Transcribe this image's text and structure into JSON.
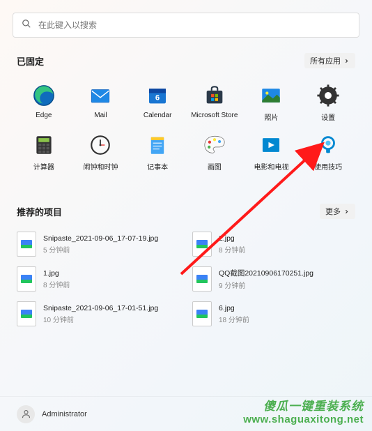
{
  "search": {
    "placeholder": "在此键入以搜索"
  },
  "pinned": {
    "title": "已固定",
    "action": "所有应用",
    "apps": [
      {
        "name": "Edge"
      },
      {
        "name": "Mail"
      },
      {
        "name": "Calendar"
      },
      {
        "name": "Microsoft Store"
      },
      {
        "name": "照片"
      },
      {
        "name": "设置"
      },
      {
        "name": "计算器"
      },
      {
        "name": "闹钟和时钟"
      },
      {
        "name": "记事本"
      },
      {
        "name": "画图"
      },
      {
        "name": "电影和电视"
      },
      {
        "name": "使用技巧"
      }
    ]
  },
  "recommended": {
    "title": "推荐的项目",
    "action": "更多",
    "items": [
      {
        "name": "Snipaste_2021-09-06_17-07-19.jpg",
        "time": "5 分钟前"
      },
      {
        "name": "2.jpg",
        "time": "8 分钟前"
      },
      {
        "name": "1.jpg",
        "time": "8 分钟前"
      },
      {
        "name": "QQ截图20210906170251.jpg",
        "time": "9 分钟前"
      },
      {
        "name": "Snipaste_2021-09-06_17-01-51.jpg",
        "time": "10 分钟前"
      },
      {
        "name": "6.jpg",
        "time": "18 分钟前"
      }
    ]
  },
  "user": {
    "name": "Administrator"
  },
  "watermark": {
    "line1": "傻瓜一键重装系统",
    "line2": "www.shaguaxitong.net"
  }
}
